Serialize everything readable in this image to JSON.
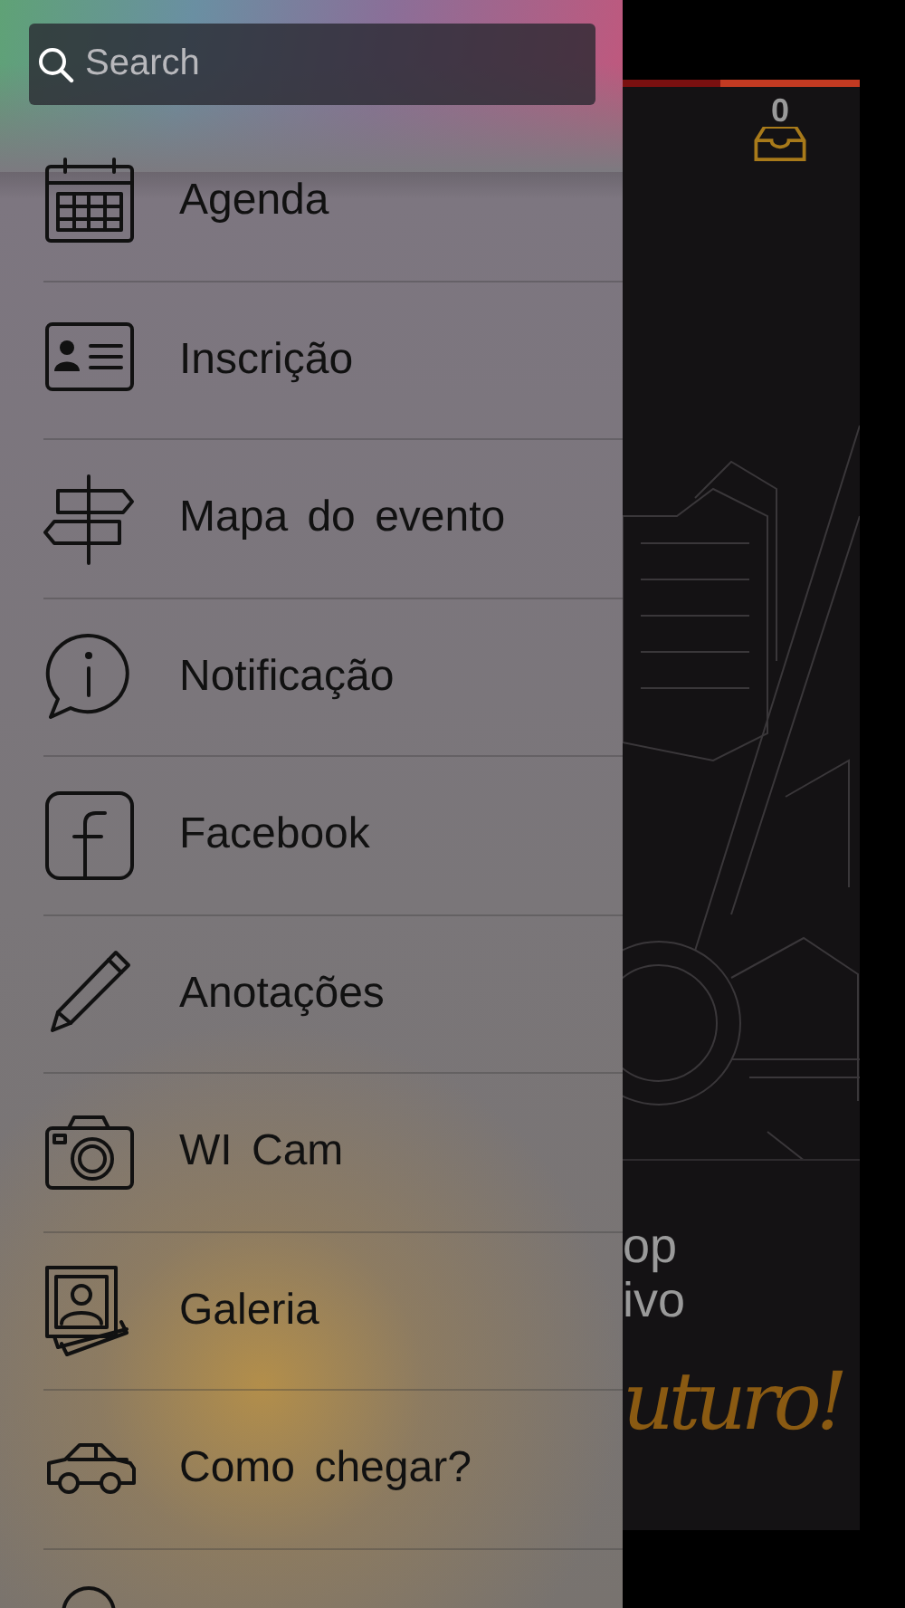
{
  "search": {
    "placeholder": "Search"
  },
  "menu": [
    {
      "label": "Agenda"
    },
    {
      "label": "Inscrição"
    },
    {
      "label": "Mapa do evento"
    },
    {
      "label": "Notificação"
    },
    {
      "label": "Facebook"
    },
    {
      "label": "Anotações"
    },
    {
      "label": "WI Cam"
    },
    {
      "label": "Galeria"
    },
    {
      "label": "Como chegar?"
    }
  ],
  "background_screen": {
    "inbox_count": "0",
    "text_lines": [
      "op",
      "ivo"
    ],
    "slogan": "uturo!"
  }
}
